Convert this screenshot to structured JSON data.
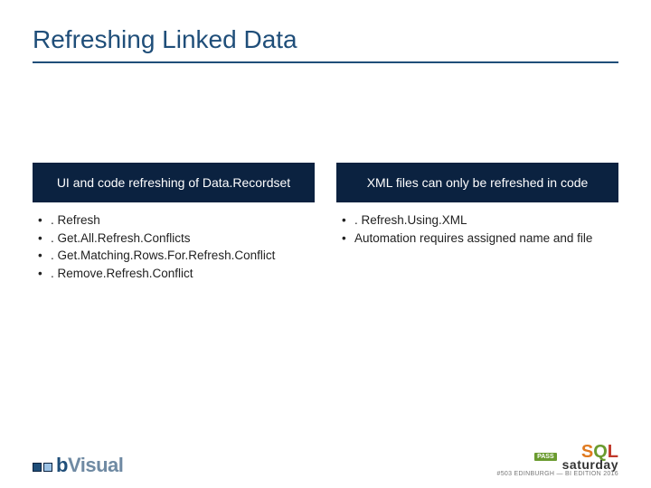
{
  "title": "Refreshing Linked Data",
  "columns": [
    {
      "heading": "UI and code refreshing of Data.Recordset",
      "items": [
        ". Refresh",
        ". Get.All.Refresh.Conflicts",
        ". Get.Matching.Rows.For.Refresh.Conflict",
        ". Remove.Refresh.Conflict"
      ]
    },
    {
      "heading": "XML files can only be refreshed in code",
      "items": [
        ". Refresh.Using.XML",
        "Automation requires assigned name and file"
      ]
    }
  ],
  "footer": {
    "left_logo": {
      "prefix": "b",
      "suffix": "Visual"
    },
    "right_logo": {
      "pass": "PASS",
      "sql": {
        "s": "S",
        "q": "Q",
        "l": "L"
      },
      "saturday": "saturday",
      "subtitle": "#503 EDINBURGH — BI EDITION 2016"
    }
  }
}
